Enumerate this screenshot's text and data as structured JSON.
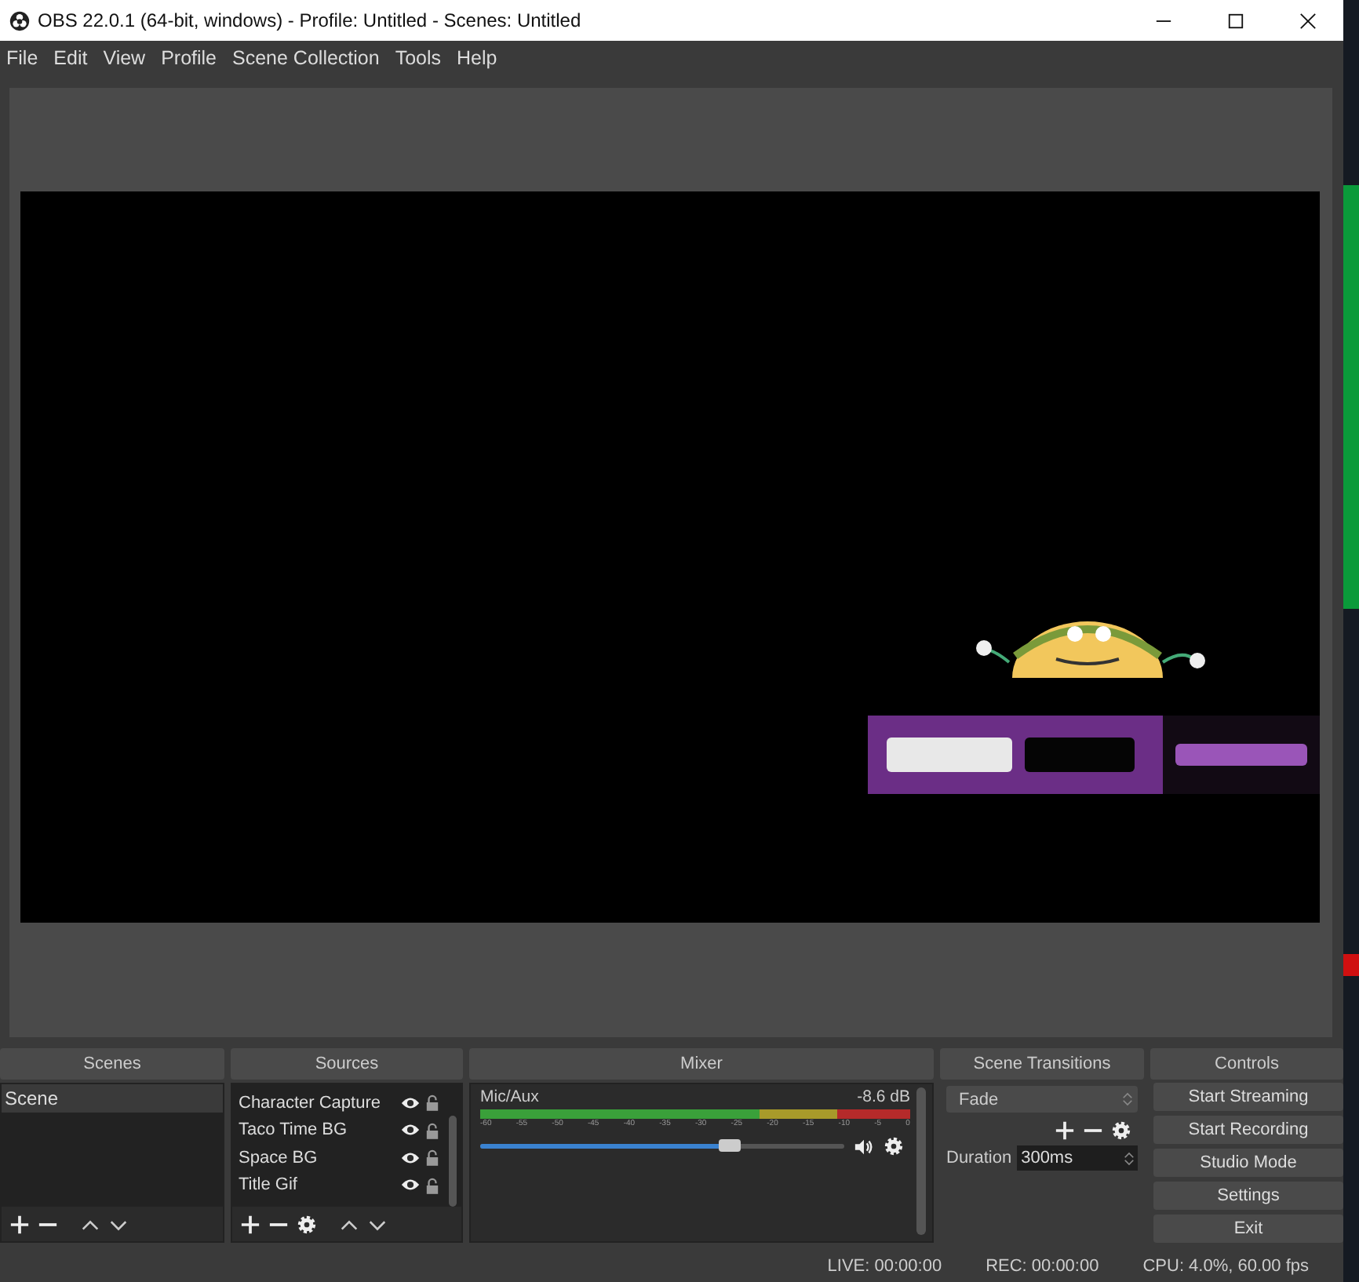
{
  "window": {
    "title": "OBS 22.0.1 (64-bit, windows) - Profile: Untitled - Scenes: Untitled"
  },
  "menu": [
    "File",
    "Edit",
    "View",
    "Profile",
    "Scene Collection",
    "Tools",
    "Help"
  ],
  "preview": {
    "kind": "picture"
  },
  "scenes": {
    "title": "Scenes",
    "items": [
      {
        "label": "Scene",
        "selected": true
      }
    ]
  },
  "sources": {
    "title": "Sources",
    "items": [
      {
        "label": "Character Capture",
        "visible": true,
        "locked": false
      },
      {
        "label": "Taco Time BG",
        "visible": true,
        "locked": false
      },
      {
        "label": "Space BG",
        "visible": true,
        "locked": false
      },
      {
        "label": "Title Gif",
        "visible": true,
        "locked": false
      }
    ]
  },
  "mixer": {
    "title": "Mixer",
    "channels": [
      {
        "name": "Mic/Aux",
        "reading": "-8.6 dB",
        "level": 0.69,
        "muted": false,
        "ticks": [
          "-60",
          "-55",
          "-50",
          "-45",
          "-40",
          "-35",
          "-30",
          "-25",
          "-20",
          "-15",
          "-10",
          "-5",
          "0"
        ]
      }
    ]
  },
  "transitions": {
    "title": "Scene Transitions",
    "selected": "Fade",
    "duration_label": "Duration",
    "duration": "300ms"
  },
  "controls": {
    "title": "Controls",
    "buttons": [
      "Start Streaming",
      "Start Recording",
      "Studio Mode",
      "Settings",
      "Exit"
    ]
  },
  "status_bar": [
    "LIVE: 00:00:00",
    "REC: 00:00:00",
    "CPU: 4.0%, 60.00 fps"
  ]
}
